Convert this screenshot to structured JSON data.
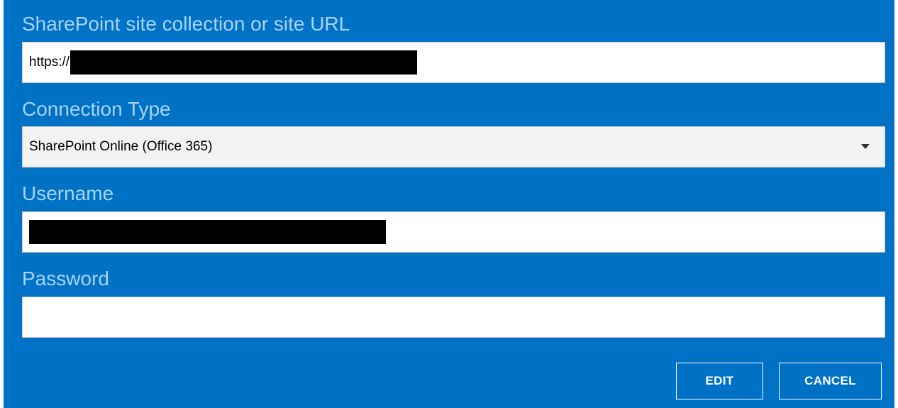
{
  "form": {
    "url_label": "SharePoint site collection or site URL",
    "url_value_prefix": "https://",
    "connection_type_label": "Connection Type",
    "connection_type_value": "SharePoint Online (Office 365)",
    "username_label": "Username",
    "password_label": "Password",
    "password_value": ""
  },
  "buttons": {
    "edit_label": "EDIT",
    "cancel_label": "CANCEL"
  },
  "colors": {
    "panel_bg": "#0072c6",
    "label_text": "#a9d3f5",
    "button_border": "#ffffff"
  },
  "icons": {
    "dropdown": "chevron-down-icon"
  }
}
